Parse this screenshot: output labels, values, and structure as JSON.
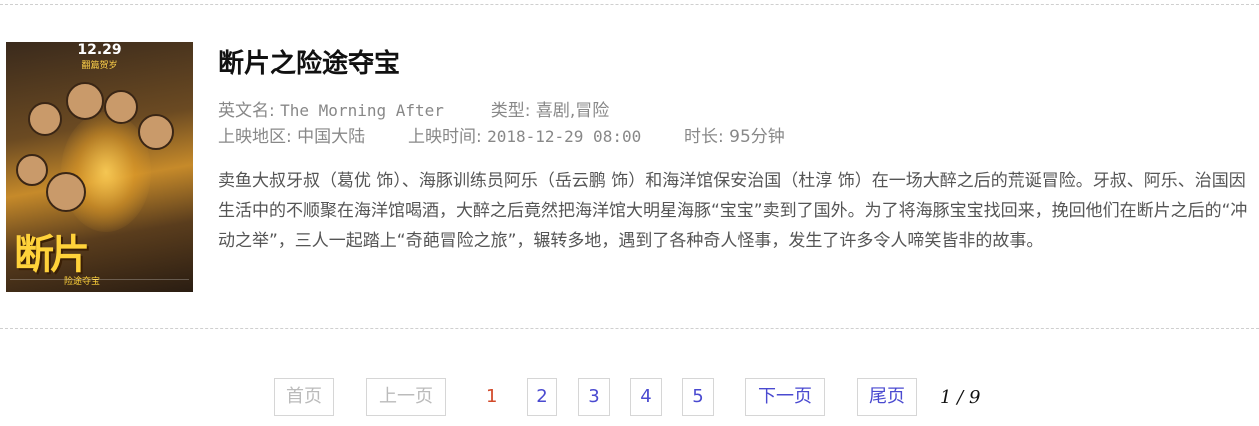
{
  "movie": {
    "title": "断片之险途夺宝",
    "en_label": "英文名:",
    "en_value": "The Morning After",
    "genre_label": "类型:",
    "genre_value": "喜剧,冒险",
    "region_label": "上映地区:",
    "region_value": "中国大陆",
    "release_label": "上映时间:",
    "release_value": "2018-12-29 08:00",
    "duration_label": "时长:",
    "duration_value": "95分钟",
    "description": "卖鱼大叔牙叔（葛优 饰）、海豚训练员阿乐（岳云鹏 饰）和海洋馆保安治国（杜淳 饰）在一场大醉之后的荒诞冒险。牙叔、阿乐、治国因生活中的不顺聚在海洋馆喝酒，大醉之后竟然把海洋馆大明星海豚“宝宝”卖到了国外。为了将海豚宝宝找回来，挽回他们在断片之后的“冲动之举”，三人一起踏上“奇葩冒险之旅”，辗转多地，遇到了各种奇人怪事，发生了许多令人啼笑皆非的故事。",
    "poster": {
      "date_text": "12.29",
      "tagline_text": "翻篇贺岁",
      "title_text": "断片",
      "subtitle_text": "险途夺宝"
    }
  },
  "pagination": {
    "first": "首页",
    "prev": "上一页",
    "current": "1",
    "pages": [
      "2",
      "3",
      "4",
      "5"
    ],
    "next": "下一页",
    "last": "尾页",
    "info": "1 / 9"
  },
  "colors": {
    "link": "#4a4ad0",
    "current_page": "#d24a2a",
    "disabled": "#bbbbbb"
  }
}
